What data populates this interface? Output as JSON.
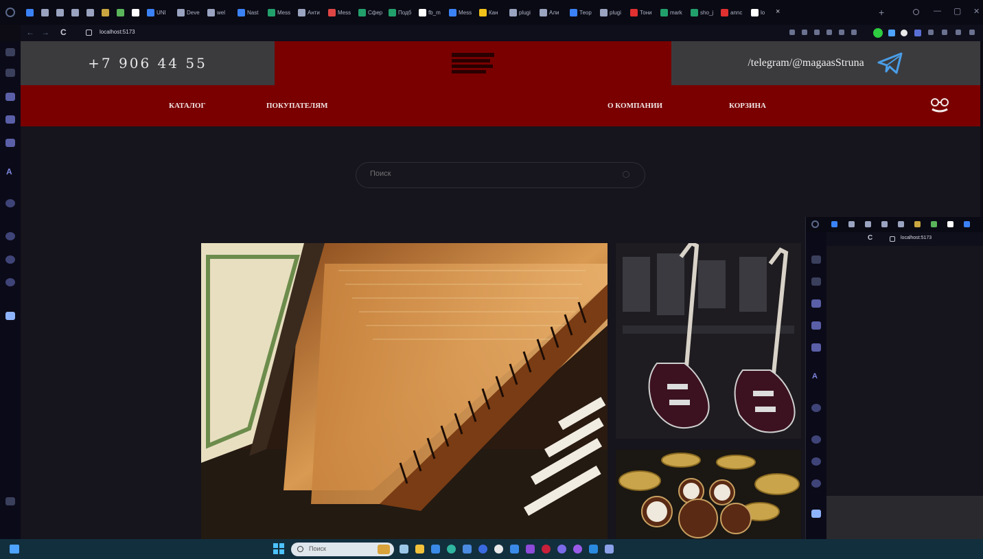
{
  "browser": {
    "tabs": [
      {
        "label": "",
        "color": "#3b82f6"
      },
      {
        "label": "",
        "color": "#9aa4c0"
      },
      {
        "label": "",
        "color": "#9aa4c0"
      },
      {
        "label": "",
        "color": "#9aa4c0"
      },
      {
        "label": "",
        "color": "#9aa4c0"
      },
      {
        "label": "",
        "color": "#caa640"
      },
      {
        "label": "",
        "color": "#5ab55a"
      },
      {
        "label": "",
        "color": "#ffffff"
      },
      {
        "label": "UNI",
        "color": "#3b82f6"
      },
      {
        "label": "Deve",
        "color": "#9aa4c0"
      },
      {
        "label": "wel",
        "color": "#9aa4c0"
      },
      {
        "label": "Nast",
        "color": "#3b82f6"
      },
      {
        "label": "Mess",
        "color": "#22a06b"
      },
      {
        "label": "Анти",
        "color": "#9aa4c0"
      },
      {
        "label": "Mess",
        "color": "#e04545"
      },
      {
        "label": "Сфер",
        "color": "#22a06b"
      },
      {
        "label": "Подб",
        "color": "#22a06b"
      },
      {
        "label": "fb_m",
        "color": "#ffffff"
      },
      {
        "label": "Mess",
        "color": "#3b82f6"
      },
      {
        "label": "Кан",
        "color": "#f2c21a"
      },
      {
        "label": "plugi",
        "color": "#9aa4c0"
      },
      {
        "label": "Али",
        "color": "#9aa4c0"
      },
      {
        "label": "Теор",
        "color": "#3b82f6"
      },
      {
        "label": "plugi",
        "color": "#9aa4c0"
      },
      {
        "label": "Тони",
        "color": "#e03030"
      },
      {
        "label": "mark",
        "color": "#22a06b"
      },
      {
        "label": "sho_j",
        "color": "#22a06b"
      },
      {
        "label": "annc",
        "color": "#e03030"
      },
      {
        "label": "lo",
        "color": "#ffffff"
      }
    ],
    "close_tab": "×",
    "new_tab": "+",
    "window_controls": {
      "min": "—",
      "max": "▢",
      "close": "✕"
    },
    "url": "localhost:5173",
    "nav_back": "←",
    "nav_forward": "→",
    "reload": "C"
  },
  "site": {
    "phone": "+7 906 44 55",
    "telegram": "/telegram/@magaasStruna",
    "logo_text": "",
    "nav": {
      "catalog": "КАТАЛОГ",
      "buyers": "ПОКУПАТЕЛЯМ",
      "company": "О КОМПАНИИ",
      "cart": "КОРЗИНА"
    },
    "search_placeholder": "Поиск",
    "gallery": [
      {
        "name": "harpsichord",
        "accent": "#b07a3a"
      },
      {
        "name": "electric-guitars",
        "accent": "#3a1e26"
      },
      {
        "name": "drum-kit",
        "accent": "#b88a3a"
      }
    ]
  },
  "overlay_window": {
    "url": "localhost:5173"
  },
  "taskbar": {
    "search_text": "Поиск"
  },
  "colors": {
    "brand_red": "#7a0000",
    "header_gray": "#3b3b3e",
    "page_bg": "#16141c",
    "taskbar_bg": "#122f3e"
  }
}
